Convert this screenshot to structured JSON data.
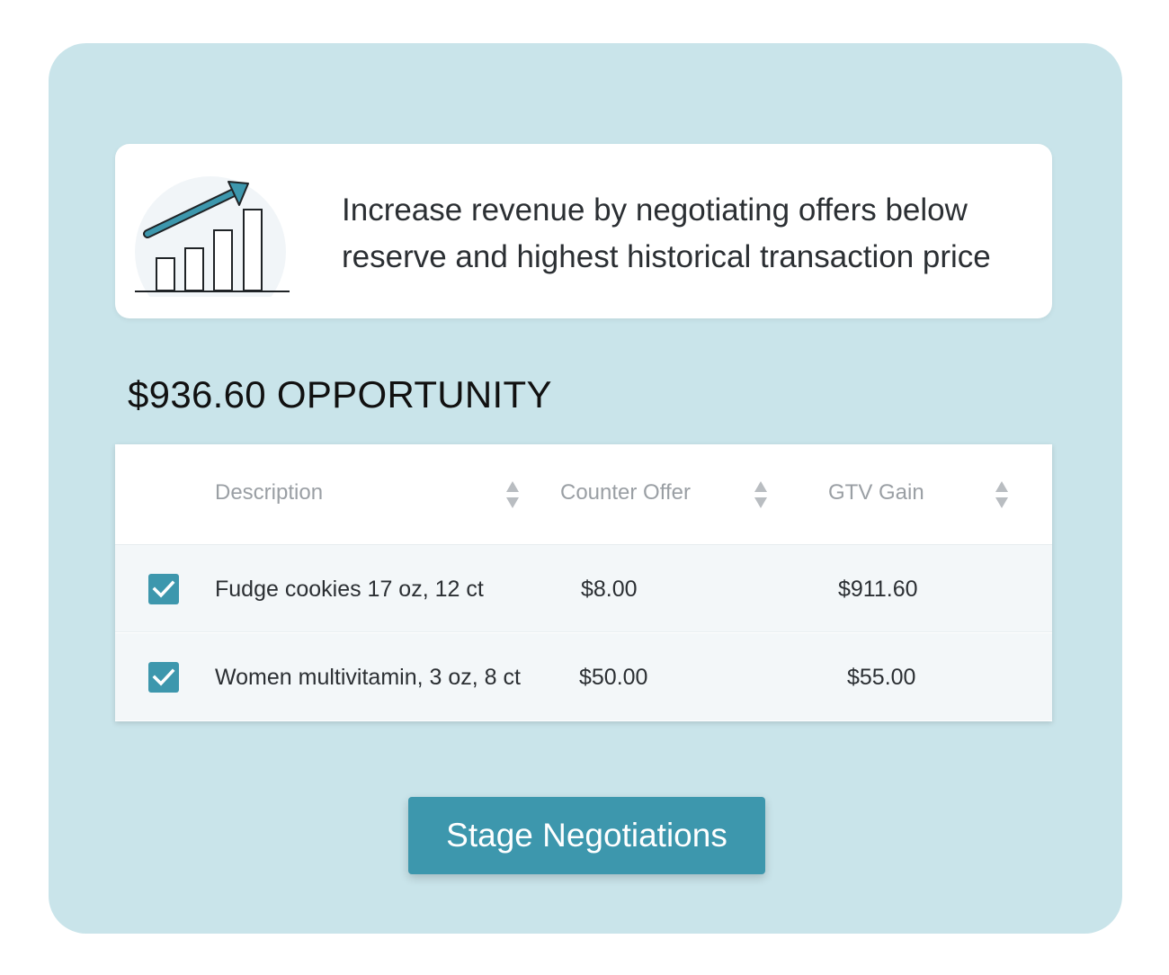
{
  "insight": {
    "illustration_icon": "bar-chart-growth-arrow-icon",
    "text": "Increase revenue by negotiating offers below reserve and highest historical transaction price"
  },
  "opportunity": {
    "title": "$936.60 OPPORTUNITY"
  },
  "table": {
    "columns": [
      {
        "label": "Description",
        "sort_icon": "sort-icon"
      },
      {
        "label": "Counter Offer",
        "sort_icon": "sort-icon"
      },
      {
        "label": "GTV Gain",
        "sort_icon": "sort-icon"
      }
    ],
    "rows": [
      {
        "checked": true,
        "description": "Fudge cookies 17 oz, 12 ct",
        "counter_offer": "$8.00",
        "gtv_gain": "$911.60"
      },
      {
        "checked": true,
        "description": "Women multivitamin, 3 oz, 8 ct",
        "counter_offer": "$50.00",
        "gtv_gain": "$55.00"
      }
    ]
  },
  "actions": {
    "stage_label": "Stage Negotiations"
  },
  "colors": {
    "panel_bg": "#c9e4ea",
    "accent": "#3d97ad",
    "row_bg": "#f3f7f9"
  }
}
